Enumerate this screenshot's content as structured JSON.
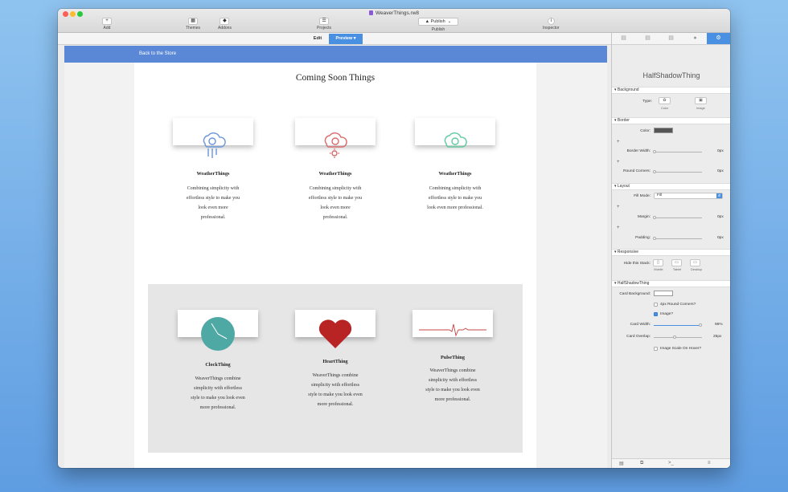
{
  "window": {
    "title": "WeaverThings.rw8"
  },
  "toolbar": {
    "add": "Add",
    "themes": "Themes",
    "addons": "Addons",
    "projects": "Projects",
    "publish_button": "Publish",
    "publish": "Publish",
    "inspector": "Inspector"
  },
  "modes": {
    "edit": "Edit",
    "preview": "Preview"
  },
  "page": {
    "back_link": "Back to the Store",
    "section_title": "Coming Soon Things",
    "top_cards": [
      {
        "name": "WeatherThings",
        "lines": [
          "Combining simplicity with",
          "effortless style to make you",
          "look even more",
          "professional."
        ],
        "icon": "cloud-rain-icon",
        "color": "#6a95d8"
      },
      {
        "name": "WeatherThings",
        "lines": [
          "Combining simplicity with",
          "effortless style to make you",
          "look even more",
          "professional."
        ],
        "icon": "cloud-sun-icon",
        "color": "#d86a6a"
      },
      {
        "name": "WeatherThings",
        "lines": [
          "Combining simplicity with",
          "effortless style to make you",
          "look even more professional."
        ],
        "icon": "cloud-icon",
        "color": "#5fc9a0"
      }
    ],
    "bottom_cards": [
      {
        "name": "ClockThing",
        "lines": [
          "WeaverThings combine",
          "simplicity with effortless",
          "style to make you look even",
          "more professional."
        ],
        "icon": "clock-icon",
        "color": "#4ea8a4"
      },
      {
        "name": "HeartThing",
        "lines": [
          "WeaverThings combine",
          "simplicity with effortless",
          "style to make you look even",
          "more professional."
        ],
        "icon": "heart-icon",
        "color": "#b82424"
      },
      {
        "name": "PulseThing",
        "lines": [
          "WeaverThings combine",
          "simplicity with effortless",
          "style to make you look even",
          "more professional."
        ],
        "icon": "pulse-icon",
        "color": "#c74444"
      }
    ]
  },
  "inspector": {
    "title": "HalfShadowThing",
    "background": {
      "header": "Background",
      "type_label": "Type:",
      "options": [
        "Color",
        "Image"
      ]
    },
    "border": {
      "header": "Border",
      "color_label": "Color:",
      "width_label": "Border Width:",
      "width_value": "0px",
      "corners_label": "Round Corners:",
      "corners_value": "0px"
    },
    "layout": {
      "header": "Layout",
      "fill_label": "Fill Mode:",
      "fill_value": "Fill",
      "margin_label": "Margin:",
      "margin_value": "0px",
      "padding_label": "Padding:",
      "padding_value": "0px"
    },
    "responsive": {
      "header": "Responsive",
      "hide_label": "Hide this Stack:",
      "options": [
        "Mobile",
        "Tablet",
        "Desktop"
      ]
    },
    "half_shadow": {
      "header": "HalfShadowThing",
      "card_bg_label": "Card Background:",
      "round_corners": "4px Round Corners?",
      "image": "Image?",
      "card_width_label": "Card Width:",
      "card_width_value": "96%",
      "card_width_fraction": 0.96,
      "overlap_label": "Card Overlap:",
      "overlap_value": "25px",
      "scale_hover": "Image Scale On Hover?"
    }
  },
  "colors": {
    "accent": "#4a90e2",
    "banner": "#5b88d6"
  }
}
